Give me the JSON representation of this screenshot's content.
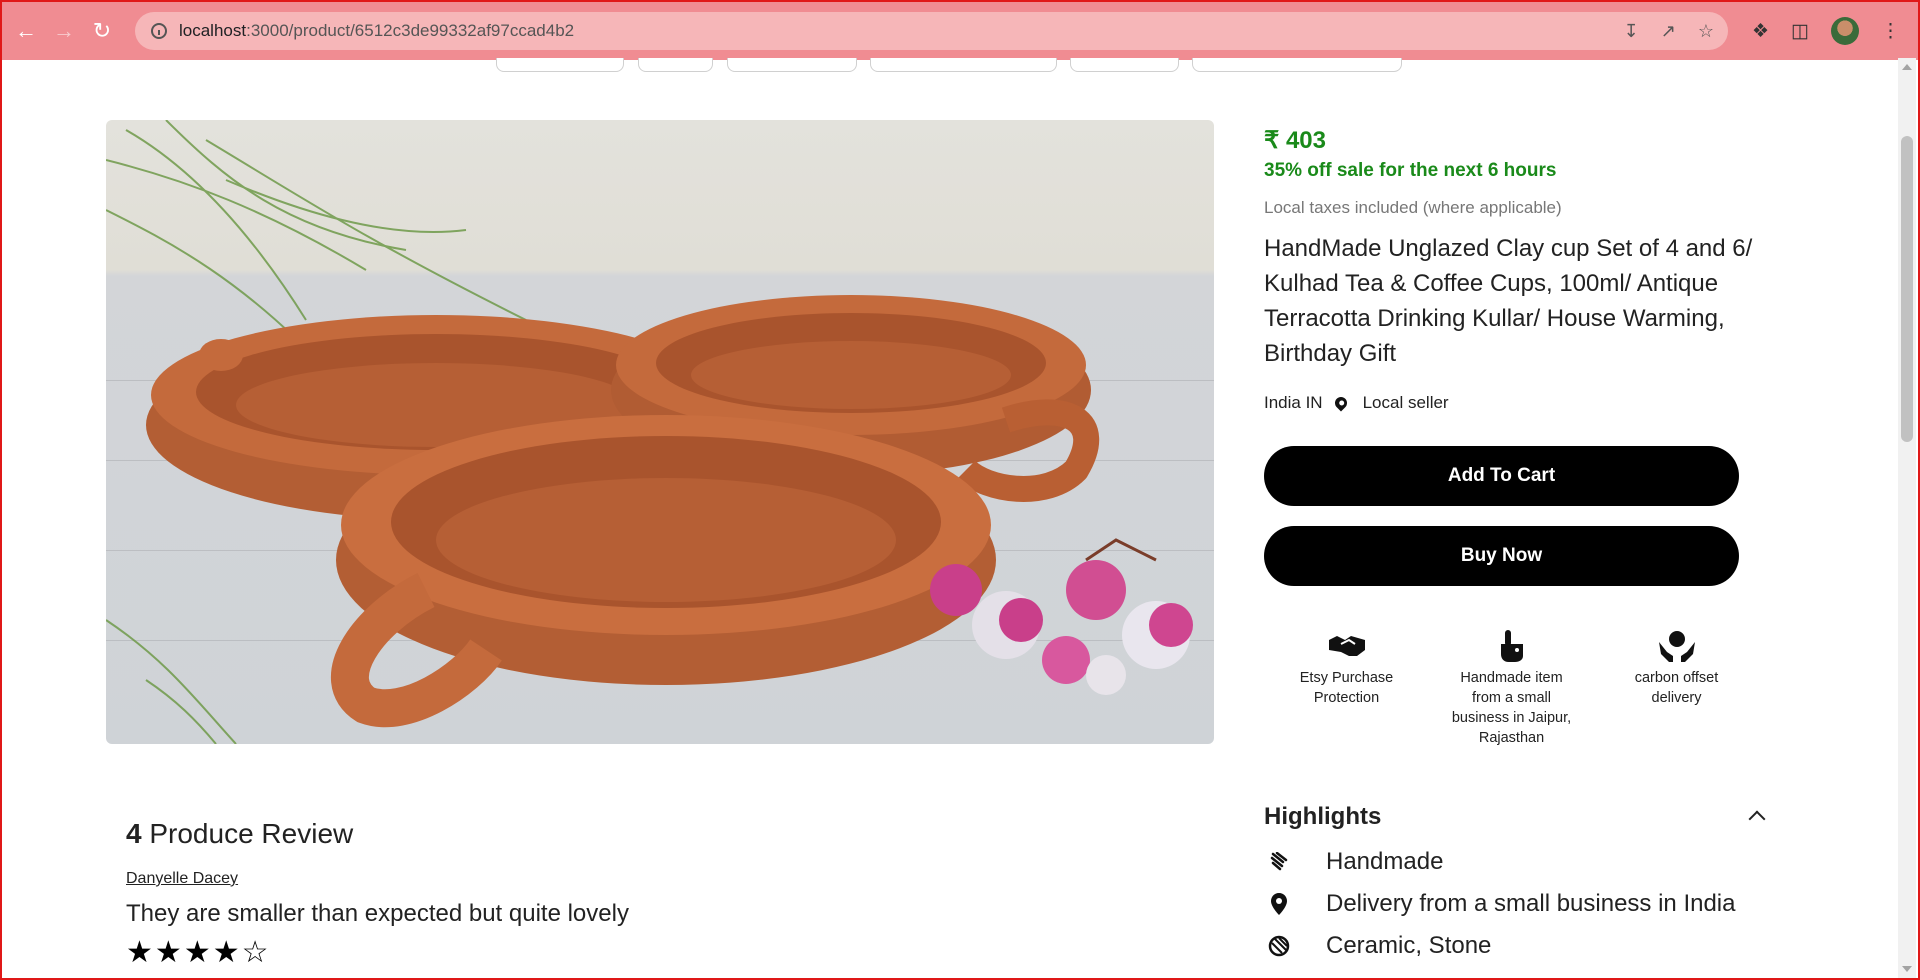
{
  "browser": {
    "url_host": "localhost",
    "url_path": ":3000/product/6512c3de99332af97ccad4b2"
  },
  "product": {
    "price": "₹ 403",
    "sale": "35% off sale for the next 6 hours",
    "tax_note": "Local taxes included (where applicable)",
    "title": "HandMade Unglazed Clay cup Set of 4 and 6/ Kulhad Tea & Coffee Cups, 100ml/ Antique Terracotta Drinking Kullar/ House Warming, Birthday Gift",
    "origin": "India IN",
    "seller_label": "Local seller",
    "add_to_cart_label": "Add To Cart",
    "buy_now_label": "Buy Now"
  },
  "features": [
    {
      "icon": "handshake-icon",
      "text": "Etsy Purchase Protection"
    },
    {
      "icon": "hand-point-icon",
      "text": "Handmade item from a small business in Jaipur, Rajasthan"
    },
    {
      "icon": "hands-holding-earth-icon",
      "text": "carbon offset delivery"
    }
  ],
  "highlights": {
    "title": "Highlights",
    "items": [
      {
        "icon": "hand-wave-icon",
        "text": "Handmade"
      },
      {
        "icon": "location-pin-icon",
        "text": "Delivery from a small business in India"
      },
      {
        "icon": "material-icon",
        "text": "Ceramic, Stone"
      }
    ]
  },
  "reviews": {
    "count": "4",
    "heading": "Produce Review",
    "items": [
      {
        "author": "Danyelle Dacey",
        "text": "They are smaller than expected but quite lovely",
        "rating": 4,
        "max": 5
      }
    ]
  },
  "colors": {
    "accent_green": "#1a8a1a",
    "button_bg": "#000000",
    "chrome_bg": "#f08c92"
  }
}
